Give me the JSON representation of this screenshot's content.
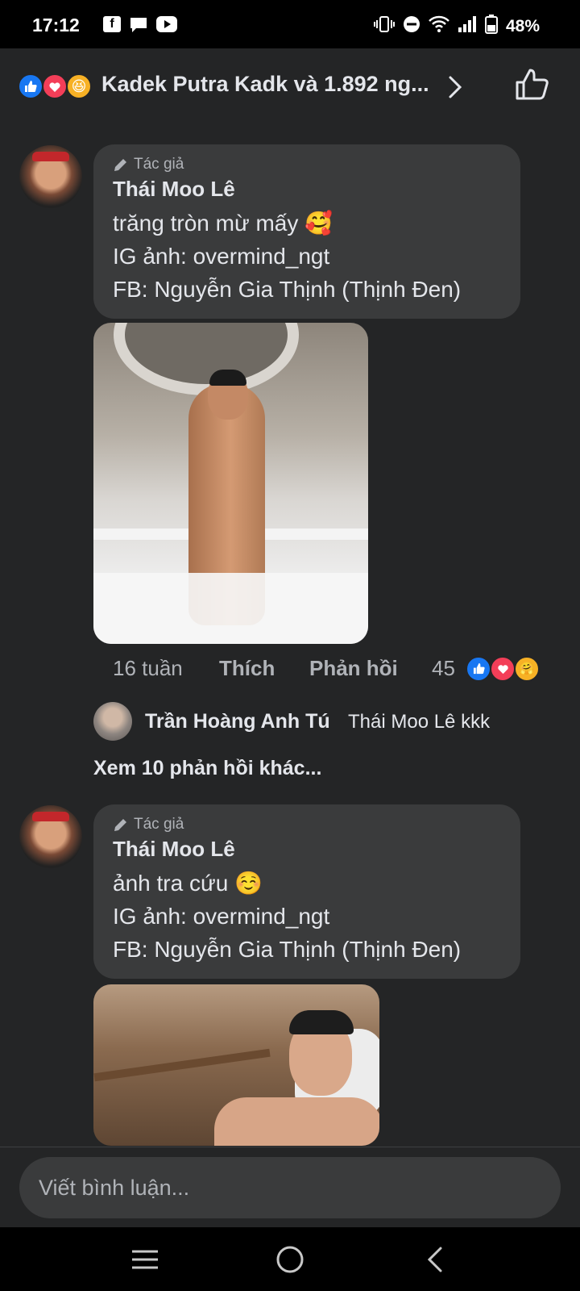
{
  "status_bar": {
    "time": "17:12",
    "battery_percent": "48%",
    "app_icons": [
      "facebook-icon",
      "messenger-icon",
      "youtube-icon"
    ],
    "system_icons": [
      "vibrate-icon",
      "do-not-disturb-icon",
      "wifi-icon",
      "signal-icon",
      "battery-icon"
    ]
  },
  "reactions_header": {
    "reactions": [
      {
        "name": "like",
        "color": "#1877f2"
      },
      {
        "name": "love",
        "color": "#f33e58"
      },
      {
        "name": "haha",
        "color": "#f7b125"
      }
    ],
    "text": "Kadek Putra Kadk và 1.892 ng..."
  },
  "comments": [
    {
      "tag": "Tác giả",
      "author": "Thái Moo Lê",
      "lines": [
        "trăng tròn mừ mấy 🥰",
        "IG ảnh: overmind_ngt",
        "FB: Nguyễn Gia Thịnh (Thịnh Đen)"
      ],
      "actions": {
        "time": "16 tuần",
        "like": "Thích",
        "reply": "Phản hồi",
        "reaction_count": "45"
      },
      "reply_preview": {
        "author": "Trần Hoàng Anh Tú",
        "text": "Thái Moo Lê kkk"
      },
      "more_replies": "Xem 10 phản hồi khác..."
    },
    {
      "tag": "Tác giả",
      "author": "Thái Moo Lê",
      "lines": [
        "ảnh tra cứu ☺️",
        "IG ảnh: overmind_ngt",
        "FB: Nguyễn Gia Thịnh (Thịnh Đen)"
      ]
    }
  ],
  "composer": {
    "placeholder": "Viết bình luận..."
  },
  "colors": {
    "background": "#242526",
    "bubble": "#3a3b3c",
    "text_primary": "#e4e6eb",
    "text_secondary": "#b0b3b8",
    "like_blue": "#1877f2",
    "love_red": "#f33e58"
  }
}
